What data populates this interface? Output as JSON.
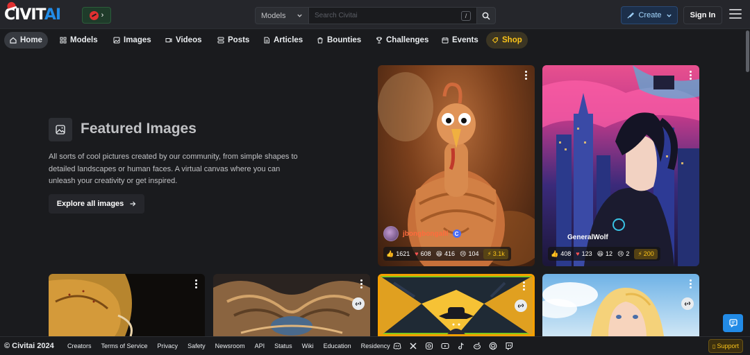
{
  "header": {
    "logo_main": "CIVIT",
    "logo_accent": "AI",
    "search_type": "Models",
    "search_placeholder": "Search Civitai",
    "search_shortcut": "/",
    "create_label": "Create",
    "signin_label": "Sign In"
  },
  "nav": {
    "items": [
      {
        "label": "Home",
        "icon": "home-icon"
      },
      {
        "label": "Models",
        "icon": "models-icon"
      },
      {
        "label": "Images",
        "icon": "image-icon"
      },
      {
        "label": "Videos",
        "icon": "video-icon"
      },
      {
        "label": "Posts",
        "icon": "posts-icon"
      },
      {
        "label": "Articles",
        "icon": "article-icon"
      },
      {
        "label": "Bounties",
        "icon": "bounty-icon"
      },
      {
        "label": "Challenges",
        "icon": "trophy-icon"
      },
      {
        "label": "Events",
        "icon": "calendar-icon"
      },
      {
        "label": "Shop",
        "icon": "shop-icon"
      }
    ]
  },
  "featured": {
    "title": "Featured Images",
    "description": "All sorts of cool pictures created by our community, from simple shapes to detailed landscapes or human faces. A virtual canvas where you can unleash your creativity or get inspired.",
    "cta": "Explore all images"
  },
  "cards": [
    {
      "username": "jbongbongalll",
      "likes": "1621",
      "hearts": "608",
      "laughs": "416",
      "cries": "104",
      "buzz": "3.1k"
    },
    {
      "username": "GeneralWolf",
      "likes": "408",
      "hearts": "123",
      "laughs": "12",
      "cries": "2",
      "buzz": "200"
    }
  ],
  "footer": {
    "copyright": "© Civitai 2024",
    "links": [
      "Creators",
      "Terms of Service",
      "Privacy",
      "Safety",
      "Newsroom",
      "API",
      "Status",
      "Wiki",
      "Education",
      "Residency"
    ],
    "socials": [
      "discord-icon",
      "x-icon",
      "instagram-icon",
      "youtube-icon",
      "tiktok-icon",
      "reddit-icon",
      "github-icon",
      "twitch-icon"
    ],
    "support_label": "Support"
  },
  "colors": {
    "background": "#1a1b1e",
    "header": "#25262b",
    "accent_blue": "#228be6",
    "shop_gold": "#fcc419"
  }
}
